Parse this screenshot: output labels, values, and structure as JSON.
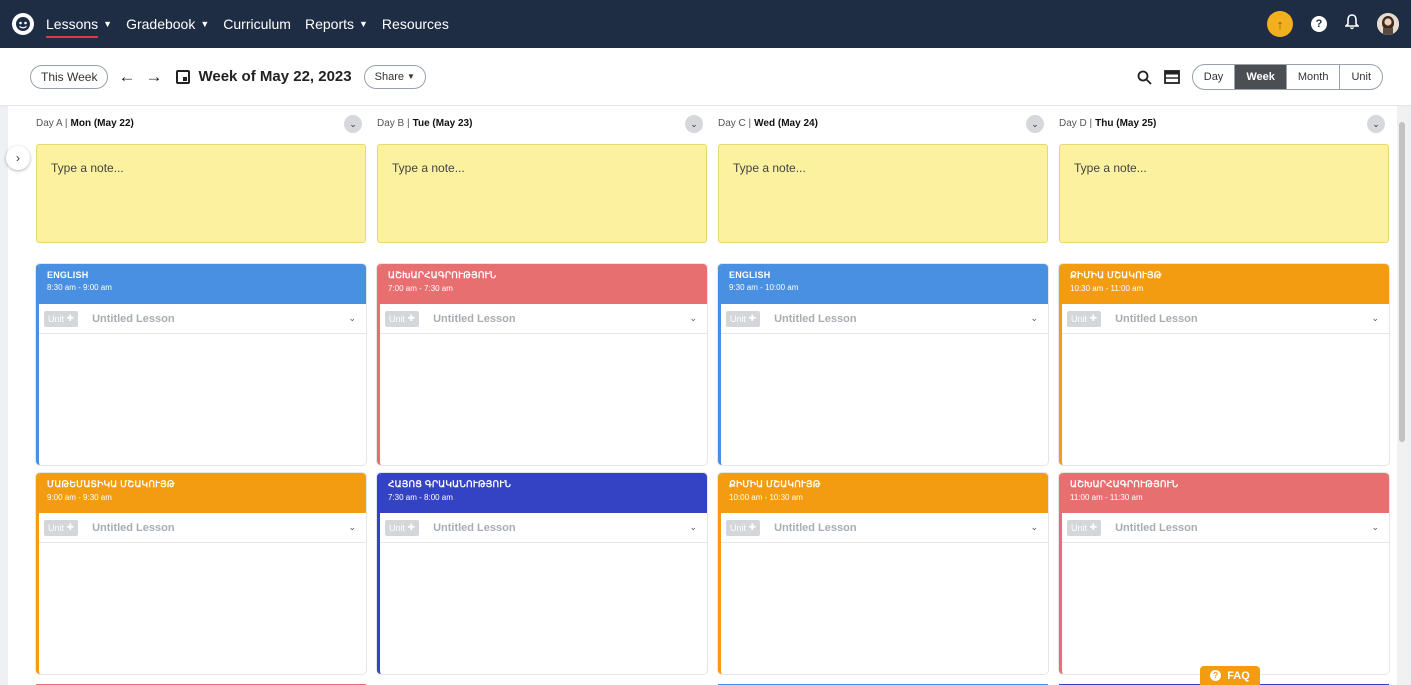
{
  "nav": {
    "items": [
      {
        "label": "Lessons",
        "dropdown": true,
        "active": true
      },
      {
        "label": "Gradebook",
        "dropdown": true
      },
      {
        "label": "Curriculum",
        "dropdown": false
      },
      {
        "label": "Reports",
        "dropdown": true
      },
      {
        "label": "Resources",
        "dropdown": false
      }
    ]
  },
  "toolbar": {
    "this_week": "This Week",
    "week_of": "Week of May 22, 2023",
    "share": "Share",
    "views": [
      "Day",
      "Week",
      "Month",
      "Unit"
    ],
    "active_view": "Week"
  },
  "days": [
    {
      "prefix": "Day A | ",
      "date": "Mon (May 22)",
      "note_placeholder": "Type a note...",
      "lessons": [
        {
          "title": "ENGLISH",
          "time": "8:30 am - 9:00 am",
          "color": "#4a90e2"
        },
        {
          "title": "ՄԱԹԵՄԱՏԻԿԱ ՄՇԱԿՈՒՅԹ",
          "time": "9:00 am - 9:30 am",
          "color": "#f39c12"
        }
      ]
    },
    {
      "prefix": "Day B | ",
      "date": "Tue (May 23)",
      "note_placeholder": "Type a note...",
      "lessons": [
        {
          "title": "ԱՇԽԱՐՀԱԳՐՈՒԹՅՈՒՆ",
          "time": "7:00 am - 7:30 am",
          "color": "#e76f6f"
        },
        {
          "title": "ՀԱՅՈՑ ԳՐԱԿԱՆՈՒԹՅՈՒՆ",
          "time": "7:30 am - 8:00 am",
          "color": "#3443c4"
        }
      ]
    },
    {
      "prefix": "Day C | ",
      "date": "Wed (May 24)",
      "note_placeholder": "Type a note...",
      "lessons": [
        {
          "title": "ENGLISH",
          "time": "9:30 am - 10:00 am",
          "color": "#4a90e2"
        },
        {
          "title": "ՔԻՄԻԱ ՄՇԱԿՈՒՅԹ",
          "time": "10:00 am - 10:30 am",
          "color": "#f39c12"
        }
      ]
    },
    {
      "prefix": "Day D | ",
      "date": "Thu (May 25)",
      "note_placeholder": "Type a note...",
      "lessons": [
        {
          "title": "ՔԻՄԻԱ ՄՇԱԿՈՒՅԹ",
          "time": "10:30 am - 11:00 am",
          "color": "#f39c12"
        },
        {
          "title": "ԱՇԽԱՐՀԱԳՐՈՒԹՅՈՒՆ",
          "time": "11:00 am - 11:30 am",
          "color": "#e76f6f"
        }
      ]
    }
  ],
  "lesson_row": {
    "unit": "Unit",
    "untitled": "Untitled Lesson"
  },
  "faq": "FAQ",
  "colors": {
    "nav_bg": "#1e2d44",
    "note": "#fcf19e",
    "upgrade": "#f2b01e"
  }
}
